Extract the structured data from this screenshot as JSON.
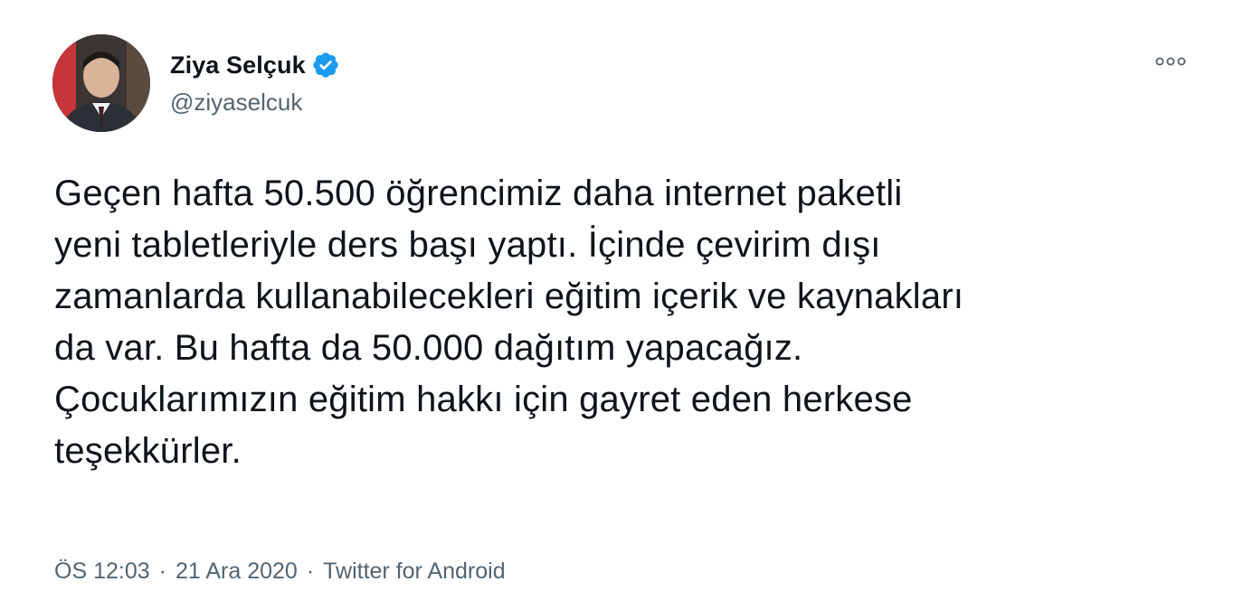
{
  "tweet": {
    "author": {
      "display_name": "Ziya Selçuk",
      "handle": "@ziyaselcuk",
      "verified": true,
      "verified_icon": "verified-badge-icon",
      "avatar": "profile-photo"
    },
    "more_icon": "more-options-icon",
    "text": "Geçen hafta 50.500 öğrencimiz daha internet paketli\nyeni tabletleriyle ders başı yaptı. İçinde çevirim dışı\nzamanlarda kullanabilecekleri eğitim içerik ve kaynakları\nda var. Bu hafta da 50.000 dağıtım yapacağız.\nÇocuklarımızın eğitim hakkı için gayret eden herkese\nteşekkürler.",
    "time": "ÖS 12:03",
    "separator": "·",
    "date": "21 Ara 2020",
    "source": "Twitter for Android"
  },
  "colors": {
    "verified_blue": "#1d9bf0",
    "secondary_text": "#536471",
    "primary_text": "#0f1419"
  }
}
